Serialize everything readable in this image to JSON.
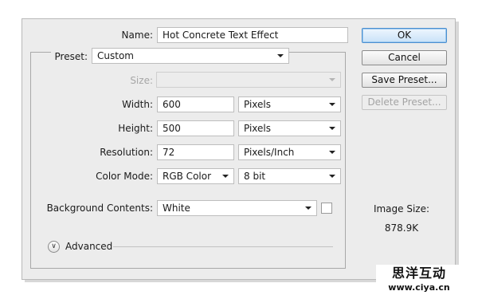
{
  "dialog": {
    "name_label": "Name:",
    "name_value": "Hot Concrete Text Effect",
    "preset_label": "Preset:",
    "preset_value": "Custom",
    "size_label": "Size:",
    "size_value": "",
    "width_label": "Width:",
    "width_value": "600",
    "width_unit": "Pixels",
    "height_label": "Height:",
    "height_value": "500",
    "height_unit": "Pixels",
    "resolution_label": "Resolution:",
    "resolution_value": "72",
    "resolution_unit": "Pixels/Inch",
    "color_mode_label": "Color Mode:",
    "color_mode_value": "RGB Color",
    "bit_depth_value": "8 bit",
    "background_label": "Background Contents:",
    "background_value": "White",
    "advanced_label": "Advanced"
  },
  "buttons": {
    "ok": "OK",
    "cancel": "Cancel",
    "save_preset": "Save Preset...",
    "delete_preset": "Delete Preset..."
  },
  "image_size": {
    "title": "Image Size:",
    "value": "878.9K"
  },
  "watermark": {
    "chinese": "思洋互动",
    "url": "www.ciya.cn"
  },
  "colors": {
    "dialog_bg": "#ececec",
    "primary_border": "#4a8fd0"
  }
}
